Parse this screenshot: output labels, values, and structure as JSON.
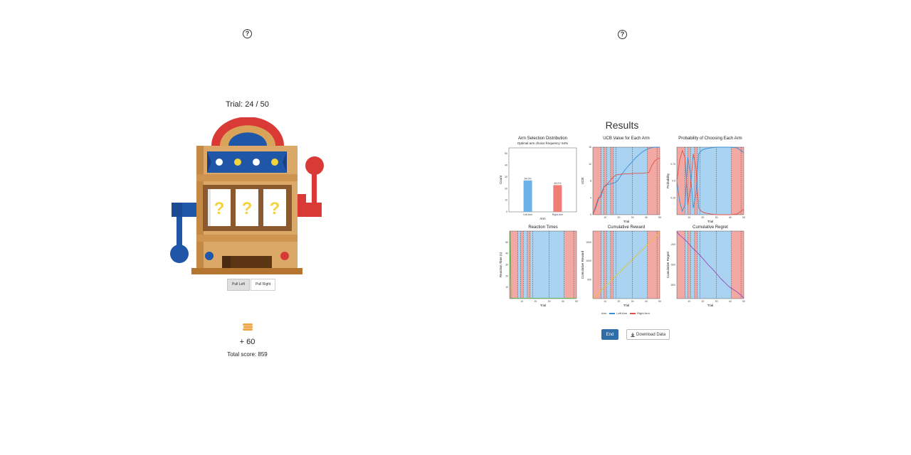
{
  "help": {
    "left_glyph": "?",
    "right_glyph": "?"
  },
  "game": {
    "trial_text": "Trial: 24 / 50",
    "buttons": {
      "pull_left": "Pull Left",
      "pull_right": "Pull Right"
    },
    "reel_symbols": [
      "?",
      "?",
      "?"
    ],
    "gain_text": "+ 60",
    "total_score_text": "Total score: 859"
  },
  "results": {
    "title": "Results",
    "legend": {
      "title": "Arm",
      "left": "Left Arm",
      "right": "Right Arm"
    },
    "end_button": "End",
    "download_button": "Download Data",
    "colors": {
      "blue_region": "#a9d3f0",
      "red_region": "#f2a9a4",
      "left_arm": "#3a8fd9",
      "right_arm": "#e0524a",
      "green": "#4fb84a",
      "yellow": "#e6c62e",
      "purple": "#9a49b8"
    }
  },
  "chart_data": [
    {
      "type": "bar",
      "title": "Arm Selection Distribution",
      "subtitle": "Optimal arm choice frequency: 64%",
      "xlabel": "Arm",
      "ylabel": "Count",
      "categories": [
        "Left Arm",
        "Right Arm"
      ],
      "values": [
        27,
        23
      ],
      "data_labels": [
        "54.0%",
        "46.0%"
      ],
      "ylim": [
        0,
        55
      ],
      "yticks": [
        0,
        10,
        20,
        30,
        40,
        50
      ]
    },
    {
      "type": "line",
      "title": "UCB Value for Each Arm",
      "xlabel": "Trial",
      "ylabel": "UCB",
      "xlim": [
        1,
        50
      ],
      "ylim": [
        0,
        16
      ],
      "xticks": [
        10,
        20,
        30,
        40,
        50
      ],
      "yticks": [
        0,
        4,
        8,
        12,
        16
      ],
      "regions": [
        {
          "start": 0,
          "end": 7,
          "arm": "right"
        },
        {
          "start": 7,
          "end": 9,
          "arm": "left"
        },
        {
          "start": 9,
          "end": 11,
          "arm": "right"
        },
        {
          "start": 11,
          "end": 14,
          "arm": "left"
        },
        {
          "start": 14,
          "end": 16,
          "arm": "right"
        },
        {
          "start": 16,
          "end": 18,
          "arm": "left"
        },
        {
          "start": 18,
          "end": 41,
          "arm": "left"
        },
        {
          "start": 41,
          "end": 50,
          "arm": "right"
        }
      ],
      "dashed_lines": [
        7,
        9,
        11,
        14,
        16,
        18,
        30,
        41,
        48
      ],
      "series": [
        {
          "name": "Left Arm",
          "x": [
            1,
            3,
            5,
            7,
            9,
            11,
            13,
            15,
            17,
            19,
            22,
            25,
            28,
            31,
            34,
            37,
            40,
            43,
            46,
            50
          ],
          "values": [
            0,
            1.5,
            3.5,
            5.0,
            6.5,
            7.2,
            7.2,
            7.4,
            7.6,
            8.0,
            9.5,
            10.8,
            11.9,
            13.0,
            14.0,
            14.8,
            15.4,
            15.8,
            16.0,
            16.0
          ]
        },
        {
          "name": "Right Arm",
          "x": [
            1,
            3,
            5,
            7,
            9,
            11,
            13,
            15,
            17,
            19,
            22,
            25,
            28,
            31,
            34,
            37,
            40,
            42,
            44,
            46,
            48,
            50
          ],
          "values": [
            0,
            2.0,
            4.0,
            4.2,
            6.5,
            7.0,
            7.8,
            8.6,
            9.2,
            9.5,
            9.6,
            9.7,
            9.7,
            9.8,
            9.8,
            9.8,
            9.9,
            10.0,
            11.5,
            12.6,
            13.2,
            13.4
          ]
        }
      ]
    },
    {
      "type": "line",
      "title": "Probability of Choosing Each Arm",
      "xlabel": "Trial",
      "ylabel": "Probability",
      "xlim": [
        1,
        50
      ],
      "ylim": [
        0,
        1
      ],
      "xticks": [
        10,
        20,
        30,
        40,
        50
      ],
      "yticks": [
        0.25,
        0.5,
        0.75
      ],
      "regions": [
        {
          "start": 0,
          "end": 7,
          "arm": "right"
        },
        {
          "start": 7,
          "end": 9,
          "arm": "left"
        },
        {
          "start": 9,
          "end": 11,
          "arm": "right"
        },
        {
          "start": 11,
          "end": 14,
          "arm": "left"
        },
        {
          "start": 14,
          "end": 16,
          "arm": "right"
        },
        {
          "start": 16,
          "end": 18,
          "arm": "left"
        },
        {
          "start": 18,
          "end": 41,
          "arm": "left"
        },
        {
          "start": 41,
          "end": 50,
          "arm": "right"
        }
      ],
      "dashed_lines": [
        7,
        9,
        11,
        14,
        16,
        18,
        30,
        41,
        48
      ],
      "series": [
        {
          "name": "Left Arm",
          "x": [
            1,
            3,
            5,
            7,
            9,
            11,
            13,
            15,
            17,
            19,
            21,
            23,
            26,
            30,
            35,
            40,
            45,
            48,
            50
          ],
          "values": [
            0.5,
            0.2,
            0.05,
            0.15,
            0.85,
            0.6,
            0.1,
            0.3,
            0.9,
            0.95,
            0.97,
            0.98,
            0.99,
            1.0,
            1.0,
            1.0,
            0.99,
            0.95,
            0.92
          ]
        },
        {
          "name": "Right Arm",
          "x": [
            1,
            3,
            5,
            7,
            9,
            11,
            13,
            15,
            17,
            19,
            21,
            23,
            26,
            30,
            35,
            40,
            45,
            48,
            50
          ],
          "values": [
            0.5,
            0.8,
            0.95,
            0.85,
            0.15,
            0.4,
            0.9,
            0.7,
            0.1,
            0.05,
            0.03,
            0.02,
            0.01,
            0.0,
            0.0,
            0.0,
            0.01,
            0.05,
            0.08
          ]
        }
      ]
    },
    {
      "type": "line",
      "title": "Reaction Times",
      "xlabel": "Trial",
      "ylabel": "Reaction Time (s)",
      "xlim": [
        1,
        50
      ],
      "ylim": [
        0,
        60
      ],
      "xticks": [
        10,
        20,
        30,
        40,
        50
      ],
      "yticks": [
        10,
        20,
        30,
        40,
        50
      ],
      "regions": [
        {
          "start": 0,
          "end": 7,
          "arm": "right"
        },
        {
          "start": 7,
          "end": 9,
          "arm": "left"
        },
        {
          "start": 9,
          "end": 11,
          "arm": "right"
        },
        {
          "start": 11,
          "end": 14,
          "arm": "left"
        },
        {
          "start": 14,
          "end": 16,
          "arm": "right"
        },
        {
          "start": 16,
          "end": 18,
          "arm": "left"
        },
        {
          "start": 18,
          "end": 41,
          "arm": "left"
        },
        {
          "start": 41,
          "end": 50,
          "arm": "right"
        }
      ],
      "dashed_lines": [
        7,
        9,
        11,
        14,
        16,
        18,
        30,
        41,
        48
      ],
      "series": [
        {
          "name": "Reaction Time",
          "x": [
            1,
            1.5,
            2,
            3,
            4,
            5,
            10,
            20,
            30,
            40,
            50
          ],
          "values": [
            10,
            60,
            0.5,
            0.4,
            0.3,
            0.3,
            0.3,
            0.3,
            0.3,
            0.3,
            0.3
          ]
        }
      ]
    },
    {
      "type": "line",
      "title": "Cumulative Reward",
      "xlabel": "Trial",
      "ylabel": "Cumulative Reward",
      "xlim": [
        1,
        50
      ],
      "ylim": [
        0,
        1800
      ],
      "xticks": [
        10,
        20,
        30,
        40,
        50
      ],
      "yticks": [
        500,
        1000,
        1500
      ],
      "regions": [
        {
          "start": 0,
          "end": 7,
          "arm": "right"
        },
        {
          "start": 7,
          "end": 9,
          "arm": "left"
        },
        {
          "start": 9,
          "end": 11,
          "arm": "right"
        },
        {
          "start": 11,
          "end": 14,
          "arm": "left"
        },
        {
          "start": 14,
          "end": 16,
          "arm": "right"
        },
        {
          "start": 16,
          "end": 18,
          "arm": "left"
        },
        {
          "start": 18,
          "end": 41,
          "arm": "left"
        },
        {
          "start": 41,
          "end": 50,
          "arm": "right"
        }
      ],
      "dashed_lines": [
        7,
        9,
        11,
        14,
        16,
        18,
        30,
        41,
        48
      ],
      "series": [
        {
          "name": "Cumulative Reward",
          "x": [
            1,
            5,
            10,
            15,
            20,
            25,
            30,
            35,
            40,
            45,
            50
          ],
          "values": [
            0,
            140,
            320,
            500,
            680,
            860,
            1040,
            1220,
            1400,
            1580,
            1760
          ]
        }
      ]
    },
    {
      "type": "line",
      "title": "Cumulative Regret",
      "xlabel": "Trial",
      "ylabel": "Cumulative Regret",
      "xlim": [
        1,
        50
      ],
      "ylim": [
        -1000,
        0
      ],
      "xticks": [
        10,
        20,
        30,
        40,
        50
      ],
      "yticks": [
        -200,
        -500,
        -800
      ],
      "regions": [
        {
          "start": 0,
          "end": 7,
          "arm": "right"
        },
        {
          "start": 7,
          "end": 9,
          "arm": "left"
        },
        {
          "start": 9,
          "end": 11,
          "arm": "right"
        },
        {
          "start": 11,
          "end": 14,
          "arm": "left"
        },
        {
          "start": 14,
          "end": 16,
          "arm": "right"
        },
        {
          "start": 16,
          "end": 18,
          "arm": "left"
        },
        {
          "start": 18,
          "end": 41,
          "arm": "left"
        },
        {
          "start": 41,
          "end": 50,
          "arm": "right"
        }
      ],
      "dashed_lines": [
        7,
        9,
        11,
        14,
        16,
        18,
        30,
        41,
        48
      ],
      "series": [
        {
          "name": "Cumulative Regret",
          "x": [
            1,
            3,
            6,
            9,
            12,
            15,
            18,
            21,
            24,
            27,
            30,
            33,
            36,
            39,
            42,
            45,
            48,
            50
          ],
          "values": [
            -10,
            -60,
            -110,
            -170,
            -240,
            -300,
            -360,
            -430,
            -500,
            -560,
            -630,
            -700,
            -760,
            -820,
            -860,
            -900,
            -950,
            -990
          ]
        }
      ]
    }
  ]
}
